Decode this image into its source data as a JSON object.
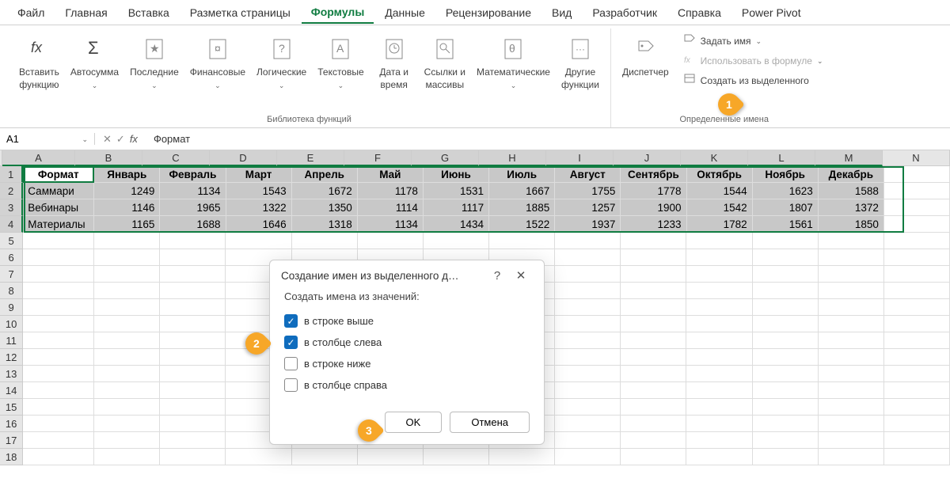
{
  "menu": [
    "Файл",
    "Главная",
    "Вставка",
    "Разметка страницы",
    "Формулы",
    "Данные",
    "Рецензирование",
    "Вид",
    "Разработчик",
    "Справка",
    "Power Pivot"
  ],
  "menu_active": 4,
  "ribbon": {
    "insert_fn": "Вставить\nфункцию",
    "autosum": "Автосумма",
    "recent": "Последние",
    "financial": "Финансовые",
    "logical": "Логические",
    "text": "Текстовые",
    "datetime": "Дата и\nвремя",
    "lookup": "Ссылки и\nмассивы",
    "math": "Математические",
    "more": "Другие\nфункции",
    "library_label": "Библиотека функций",
    "name_mgr": "Диспетчер",
    "define_name": "Задать имя",
    "use_in_formula": "Использовать в формуле",
    "create_from_sel": "Создать из выделенного",
    "defined_names_label": "Определенные имена"
  },
  "name_box": "A1",
  "formula_value": "Формат",
  "columns": [
    "A",
    "B",
    "C",
    "D",
    "E",
    "F",
    "G",
    "H",
    "I",
    "J",
    "K",
    "L",
    "M",
    "N"
  ],
  "header_row": [
    "Формат",
    "Январь",
    "Февраль",
    "Март",
    "Апрель",
    "Май",
    "Июнь",
    "Июль",
    "Август",
    "Сентябрь",
    "Октябрь",
    "Ноябрь",
    "Декабрь"
  ],
  "data_rows": [
    {
      "label": "Саммари",
      "vals": [
        1249,
        1134,
        1543,
        1672,
        1178,
        1531,
        1667,
        1755,
        1778,
        1544,
        1623,
        1588
      ]
    },
    {
      "label": "Вебинары",
      "vals": [
        1146,
        1965,
        1322,
        1350,
        1114,
        1117,
        1885,
        1257,
        1900,
        1542,
        1807,
        1372
      ]
    },
    {
      "label": "Материалы",
      "vals": [
        1165,
        1688,
        1646,
        1318,
        1134,
        1434,
        1522,
        1937,
        1233,
        1782,
        1561,
        1850
      ]
    }
  ],
  "dialog": {
    "title": "Создание имен из выделенного д…",
    "subtitle": "Создать имена из значений:",
    "opt_top": "в строке выше",
    "opt_left": "в столбце слева",
    "opt_bottom": "в строке ниже",
    "opt_right": "в столбце справа",
    "ok": "OK",
    "cancel": "Отмена"
  },
  "callouts": {
    "c1": "1",
    "c2": "2",
    "c3": "3"
  }
}
